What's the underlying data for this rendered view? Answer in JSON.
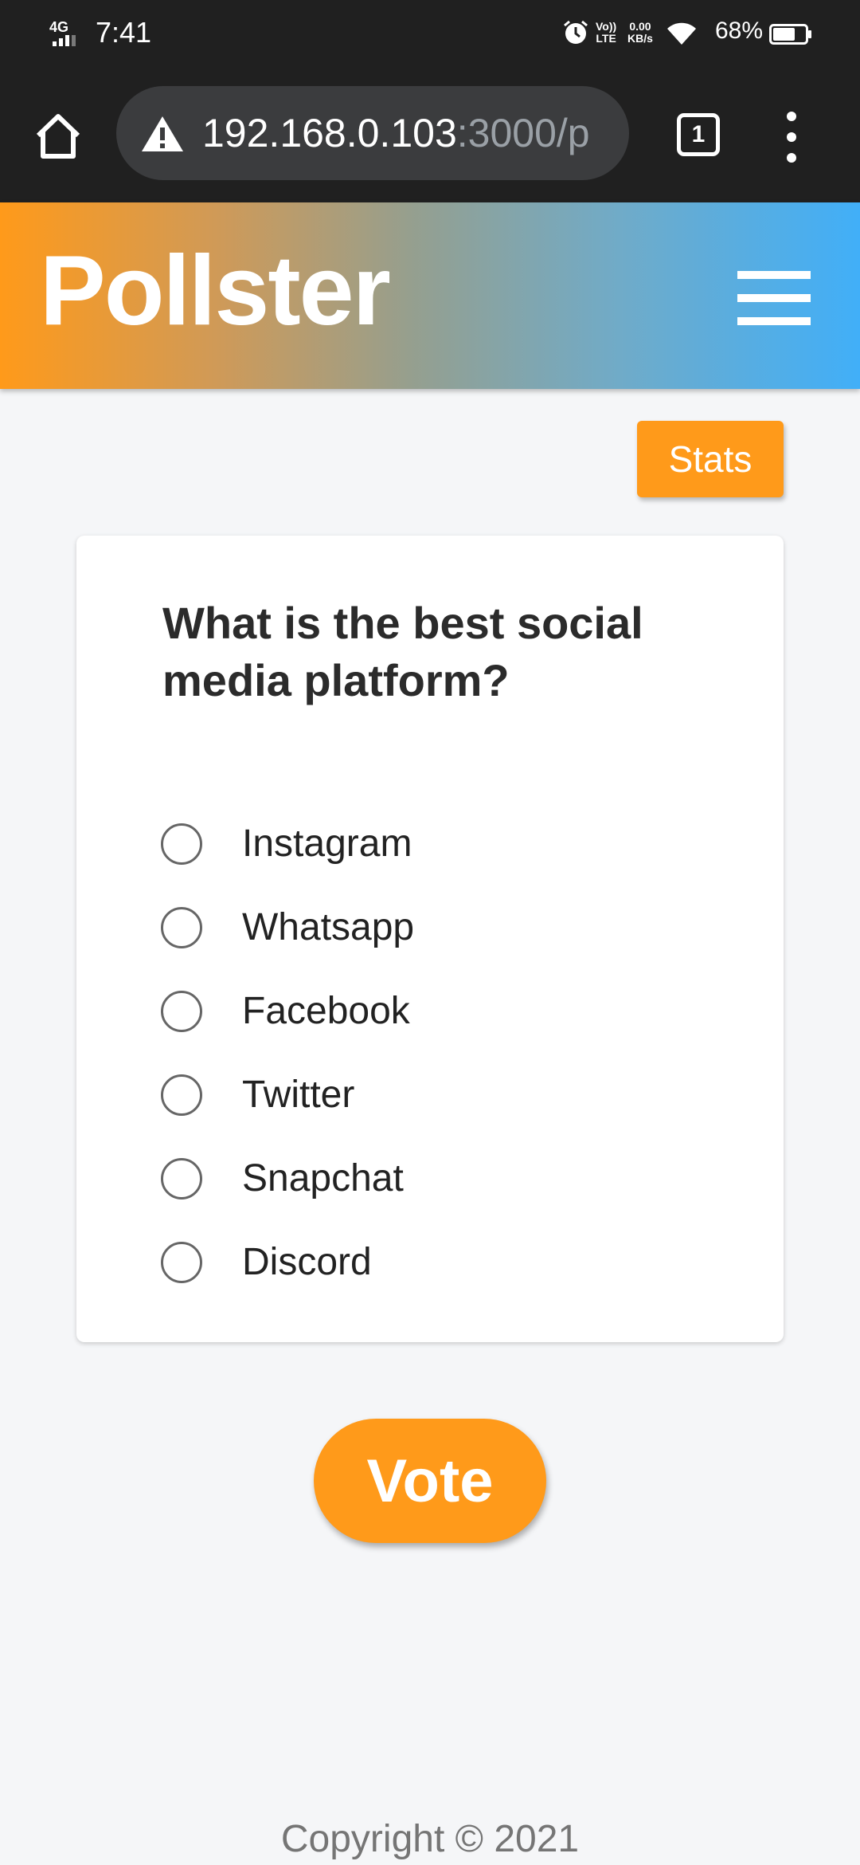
{
  "status_bar": {
    "network": "4G",
    "time": "7:41",
    "volte_top": "Vo))",
    "volte_bottom": "LTE",
    "speed_value": "0.00",
    "speed_unit": "KB/s",
    "battery_percent": "68%",
    "battery_level": 0.68
  },
  "browser": {
    "url_host": "192.168.0.103",
    "url_rest": ":3000/p",
    "tab_count": "1"
  },
  "app": {
    "brand": "Pollster",
    "accent_color": "#ff9a1a",
    "gradient_end_color": "#41aff8"
  },
  "actions": {
    "stats_label": "Stats",
    "vote_label": "Vote"
  },
  "poll": {
    "question": "What is the best social media platform?",
    "options": [
      {
        "label": "Instagram",
        "selected": false
      },
      {
        "label": "Whatsapp",
        "selected": false
      },
      {
        "label": "Facebook",
        "selected": false
      },
      {
        "label": "Twitter",
        "selected": false
      },
      {
        "label": "Snapchat",
        "selected": false
      },
      {
        "label": "Discord",
        "selected": false
      }
    ]
  },
  "footer": {
    "copyright": "Copyright © 2021"
  }
}
